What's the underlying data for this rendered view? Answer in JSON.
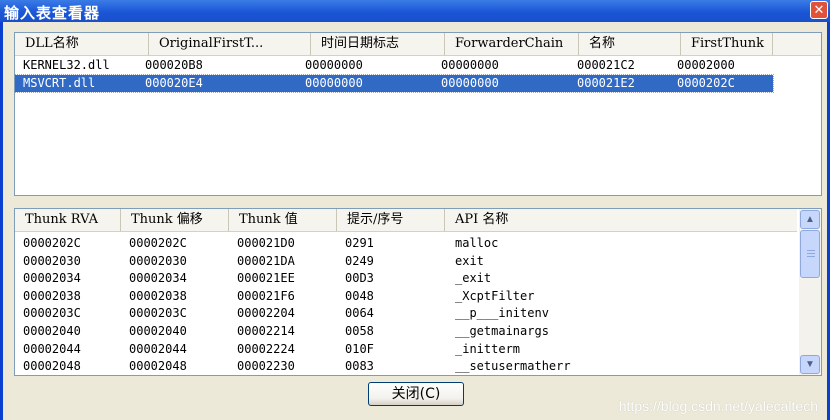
{
  "window": {
    "title": "输入表查看器",
    "close_glyph": "✕"
  },
  "dll_table": {
    "columns": [
      "DLL名称",
      "OriginalFirstT...",
      "时间日期标志",
      "ForwarderChain",
      "名称",
      "FirstThunk"
    ],
    "rows": [
      {
        "selected": false,
        "cells": [
          "KERNEL32.dll",
          "000020B8",
          "00000000",
          "00000000",
          "000021C2",
          "00002000"
        ]
      },
      {
        "selected": true,
        "cells": [
          "MSVCRT.dll",
          "000020E4",
          "00000000",
          "00000000",
          "000021E2",
          "0000202C"
        ]
      }
    ]
  },
  "thunk_table": {
    "columns": [
      "Thunk RVA",
      "Thunk 偏移",
      "Thunk 值",
      "提示/序号",
      "API 名称"
    ],
    "rows": [
      [
        "0000202C",
        "0000202C",
        "000021D0",
        "0291",
        "malloc"
      ],
      [
        "00002030",
        "00002030",
        "000021DA",
        "0249",
        "exit"
      ],
      [
        "00002034",
        "00002034",
        "000021EE",
        "00D3",
        "_exit"
      ],
      [
        "00002038",
        "00002038",
        "000021F6",
        "0048",
        "_XcptFilter"
      ],
      [
        "0000203C",
        "0000203C",
        "00002204",
        "0064",
        "__p___initenv"
      ],
      [
        "00002040",
        "00002040",
        "00002214",
        "0058",
        "__getmainargs"
      ],
      [
        "00002044",
        "00002044",
        "00002224",
        "010F",
        "_initterm"
      ],
      [
        "00002048",
        "00002048",
        "00002230",
        "0083",
        "__setusermatherr"
      ]
    ]
  },
  "scrollbar": {
    "up_glyph": "▲",
    "down_glyph": "▼"
  },
  "buttons": {
    "close_label": "关闭(C)"
  },
  "watermark": "https://blog.csdn.net/yalecaltech",
  "colors": {
    "titlebar": "#1b56d6",
    "selection": "#316ac5",
    "face": "#ece9d8"
  }
}
